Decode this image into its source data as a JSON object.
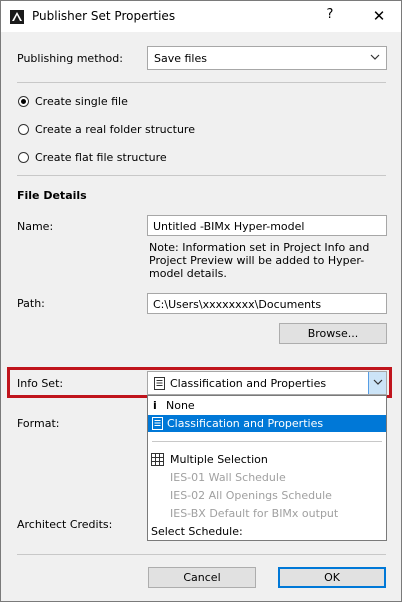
{
  "window": {
    "title": "Publisher Set Properties",
    "help": "?",
    "close": "✕"
  },
  "publishing": {
    "label": "Publishing method:",
    "value": "Save files"
  },
  "radios": [
    {
      "label": "Create single file",
      "selected": true
    },
    {
      "label": "Create a real folder structure",
      "selected": false
    },
    {
      "label": "Create flat file structure",
      "selected": false
    }
  ],
  "file_details": {
    "heading": "File Details",
    "name_label": "Name:",
    "name_value": "Untitled -BIMx Hyper-model",
    "note": "Note: Information set in Project Info and Project Preview will be added to Hyper-model details.",
    "path_label": "Path:",
    "path_value": "C:\\Users\\xxxxxxxx\\Documents",
    "browse": "Browse..."
  },
  "info_set": {
    "label": "Info Set:",
    "value": "Classification and Properties",
    "items": [
      {
        "label": "None",
        "icon": "info-icon",
        "state": "normal"
      },
      {
        "label": "Classification and Properties",
        "icon": "document-icon",
        "state": "selected"
      },
      {
        "label": "Multiple Selection",
        "icon": "grid-icon",
        "state": "normal"
      },
      {
        "label": "IES-01 Wall Schedule",
        "icon": "",
        "state": "disabled"
      },
      {
        "label": "IES-02 All Openings Schedule",
        "icon": "",
        "state": "disabled"
      },
      {
        "label": "IES-BX Default for BIMx output",
        "icon": "",
        "state": "disabled"
      },
      {
        "label": "Select Schedule:",
        "icon": "",
        "state": "normal"
      }
    ]
  },
  "format": {
    "label": "Format:"
  },
  "architect_credits": {
    "label": "Architect Credits:"
  },
  "footer": {
    "cancel": "Cancel",
    "ok": "OK"
  },
  "colors": {
    "selection": "#0078d7",
    "highlight_border": "#c0141c",
    "dropdown_button": "#cce4f7"
  }
}
